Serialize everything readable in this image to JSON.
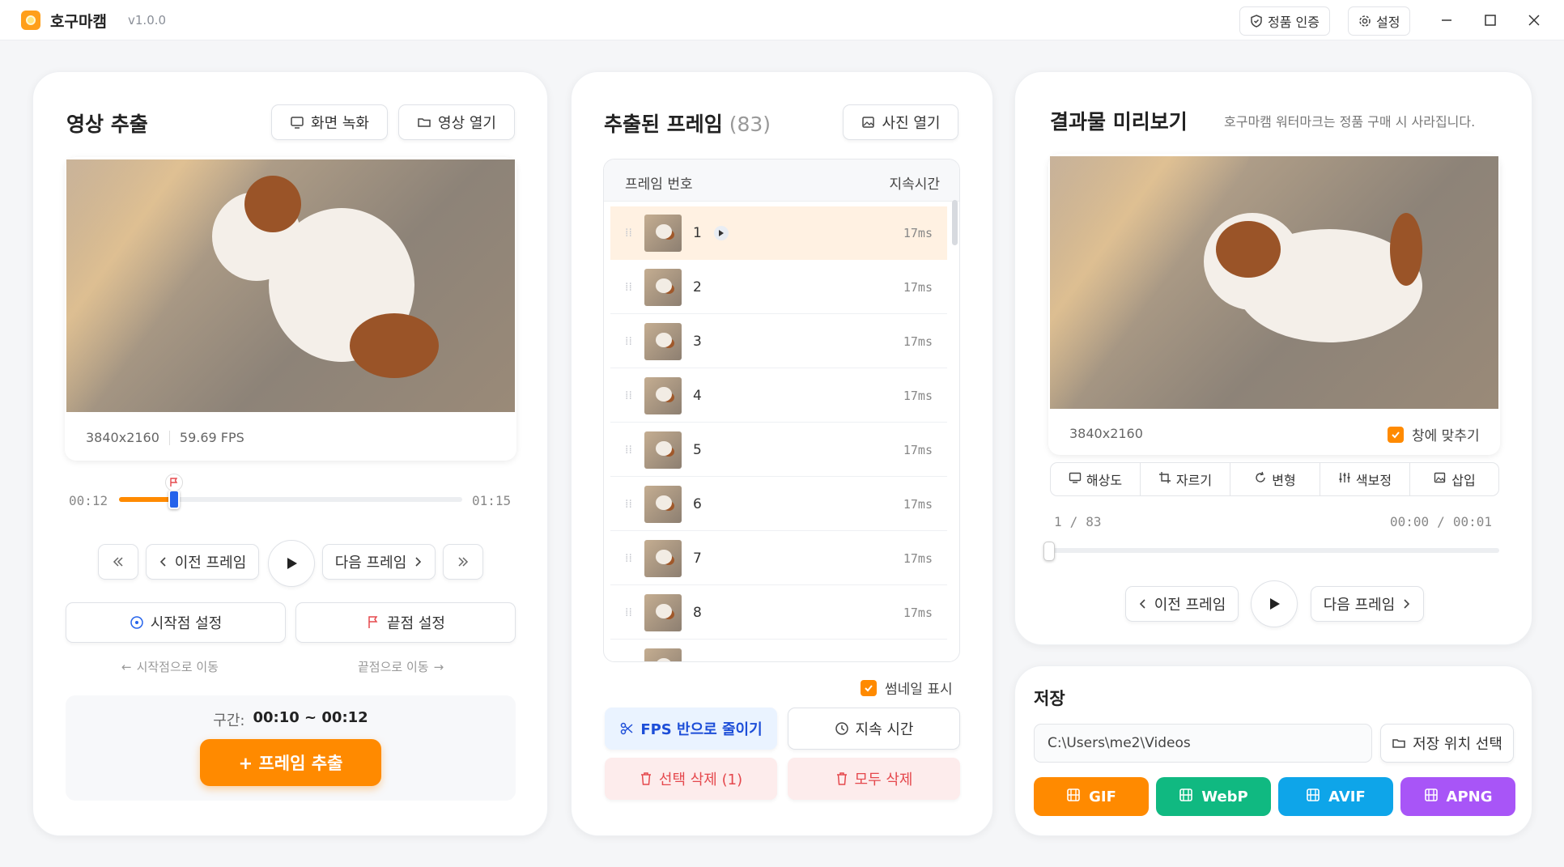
{
  "app": {
    "title": "호구마캠",
    "version": "v1.0.0"
  },
  "titlebar": {
    "license_label": "정품 인증",
    "settings_label": "설정"
  },
  "extract": {
    "title": "영상 추출",
    "record_label": "화면 녹화",
    "open_video_label": "영상 열기",
    "resolution": "3840x2160",
    "fps": "59.69 FPS",
    "time_current": "00:12",
    "time_total": "01:15",
    "timeline_progress": 0.16,
    "prev_frame_label": "이전 프레임",
    "next_frame_label": "다음 프레임",
    "set_start_label": "시작점 설정",
    "set_end_label": "끝점 설정",
    "goto_start_label": "시작점으로 이동",
    "goto_end_label": "끝점으로 이동",
    "range_label": "구간:",
    "range_value": "00:10 ~ 00:12",
    "extract_button_label": "+ 프레임 추출"
  },
  "frames": {
    "title": "추출된 프레임",
    "count": "(83)",
    "open_photo_label": "사진 열기",
    "col_frame": "프레임 번호",
    "col_duration": "지속시간",
    "rows": [
      {
        "num": "1",
        "duration": "17ms"
      },
      {
        "num": "2",
        "duration": "17ms"
      },
      {
        "num": "3",
        "duration": "17ms"
      },
      {
        "num": "4",
        "duration": "17ms"
      },
      {
        "num": "5",
        "duration": "17ms"
      },
      {
        "num": "6",
        "duration": "17ms"
      },
      {
        "num": "7",
        "duration": "17ms"
      },
      {
        "num": "8",
        "duration": "17ms"
      }
    ],
    "thumbnail_toggle_label": "썸네일 표시",
    "halve_fps_label": "FPS 반으로 줄이기",
    "duration_label": "지속 시간",
    "delete_selected_label": "선택 삭제 (1)",
    "delete_all_label": "모두 삭제"
  },
  "preview": {
    "title": "결과물 미리보기",
    "watermark_note": "호구마캠 워터마크는 정품 구매 시 사라집니다.",
    "resolution": "3840x2160",
    "fit_label": "창에 맞추기",
    "tools": [
      "해상도",
      "자르기",
      "변형",
      "색보정",
      "삽입"
    ],
    "frame_pos": "1",
    "frame_sep": "/",
    "frame_total": "83",
    "time_current": "00:00",
    "time_sep": "/",
    "time_total": "00:01",
    "prev_frame_label": "이전 프레임",
    "next_frame_label": "다음 프레임"
  },
  "save": {
    "title": "저장",
    "path": "C:\\Users\\me2\\Videos",
    "choose_location_label": "저장 위치 선택",
    "formats": [
      {
        "label": "GIF",
        "color": "#ff8a00"
      },
      {
        "label": "WebP",
        "color": "#10b981"
      },
      {
        "label": "AVIF",
        "color": "#0ea5e9"
      },
      {
        "label": "APNG",
        "color": "#a855f7"
      }
    ]
  },
  "colors": {
    "accent": "#ff8a00",
    "blue": "#3b82f6",
    "danger": "#e5484d"
  }
}
